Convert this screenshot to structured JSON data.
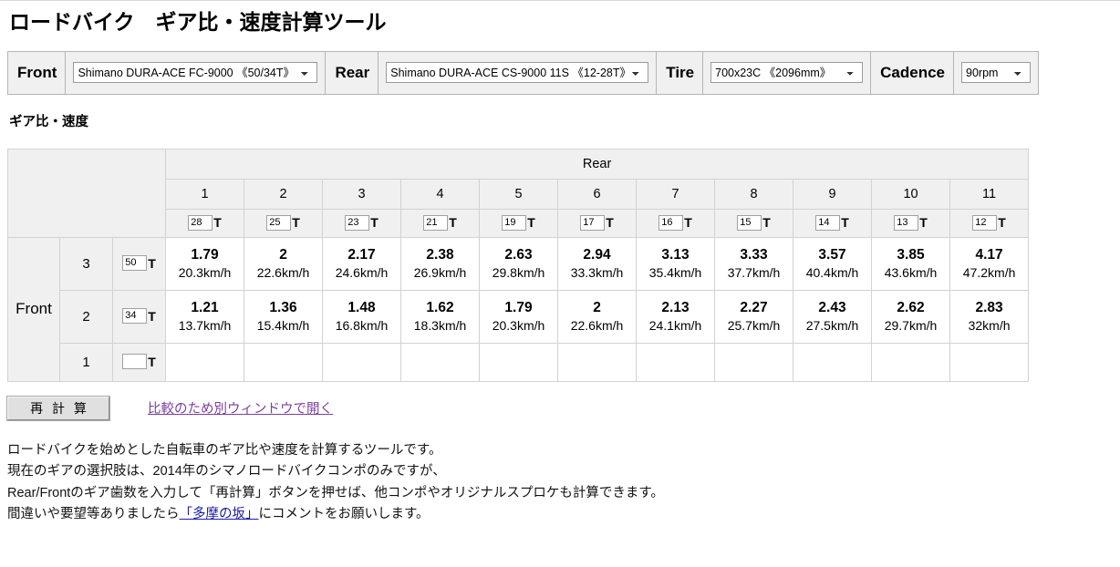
{
  "title": "ロードバイク　ギア比・速度計算ツール",
  "controls": {
    "front": {
      "label": "Front",
      "value": "Shimano DURA-ACE FC-9000 《50/34T》",
      "icon": "chevron-down-icon"
    },
    "rear": {
      "label": "Rear",
      "value": "Shimano DURA-ACE CS-9000 11S 《12-28T》",
      "icon": "chevron-down-icon"
    },
    "tire": {
      "label": "Tire",
      "value": "700x23C 《2096mm》",
      "icon": "chevron-down-icon"
    },
    "cadence": {
      "label": "Cadence",
      "value": "90rpm",
      "icon": "chevron-down-icon"
    }
  },
  "section_title": "ギア比・速度",
  "table": {
    "rear_header": "Rear",
    "front_header": "Front",
    "tooth_unit": "T",
    "rear_columns": [
      "1",
      "2",
      "3",
      "4",
      "5",
      "6",
      "7",
      "8",
      "9",
      "10",
      "11"
    ],
    "rear_teeth": [
      "28",
      "25",
      "23",
      "21",
      "19",
      "17",
      "16",
      "15",
      "14",
      "13",
      "12"
    ],
    "front_rows": [
      {
        "gear": "3",
        "teeth": "50",
        "ratios": [
          "1.79",
          "2",
          "2.17",
          "2.38",
          "2.63",
          "2.94",
          "3.13",
          "3.33",
          "3.57",
          "3.85",
          "4.17"
        ],
        "speeds": [
          "20.3km/h",
          "22.6km/h",
          "24.6km/h",
          "26.9km/h",
          "29.8km/h",
          "33.3km/h",
          "35.4km/h",
          "37.7km/h",
          "40.4km/h",
          "43.6km/h",
          "47.2km/h"
        ]
      },
      {
        "gear": "2",
        "teeth": "34",
        "ratios": [
          "1.21",
          "1.36",
          "1.48",
          "1.62",
          "1.79",
          "2",
          "2.13",
          "2.27",
          "2.43",
          "2.62",
          "2.83"
        ],
        "speeds": [
          "13.7km/h",
          "15.4km/h",
          "16.8km/h",
          "18.3km/h",
          "20.3km/h",
          "22.6km/h",
          "24.1km/h",
          "25.7km/h",
          "27.5km/h",
          "29.7km/h",
          "32km/h"
        ]
      },
      {
        "gear": "1",
        "teeth": "",
        "ratios": [
          "",
          "",
          "",
          "",
          "",
          "",
          "",
          "",
          "",
          "",
          ""
        ],
        "speeds": [
          "",
          "",
          "",
          "",
          "",
          "",
          "",
          "",
          "",
          "",
          ""
        ]
      }
    ]
  },
  "actions": {
    "recalculate_label": "再 計 算",
    "open_window_link": "比較のため別ウィンドウで開く"
  },
  "notes": {
    "line1": "ロードバイクを始めとした自転車のギア比や速度を計算するツールです。",
    "line2": "現在のギアの選択肢は、2014年のシマノロードバイクコンポのみですが、",
    "line3": "Rear/Frontのギア歯数を入力して「再計算」ボタンを押せば、他コンポやオリジナルスプロケも計算できます。",
    "line4_before": "間違いや要望等ありましたら",
    "line4_link": "「多摩の坂」",
    "line4_after": "にコメントをお願いします。"
  },
  "colors": {
    "header_bg": "#f0f0f0",
    "border": "#d2d2d2",
    "visited_link": "#7b3fa0",
    "link": "#1a1aa8"
  }
}
